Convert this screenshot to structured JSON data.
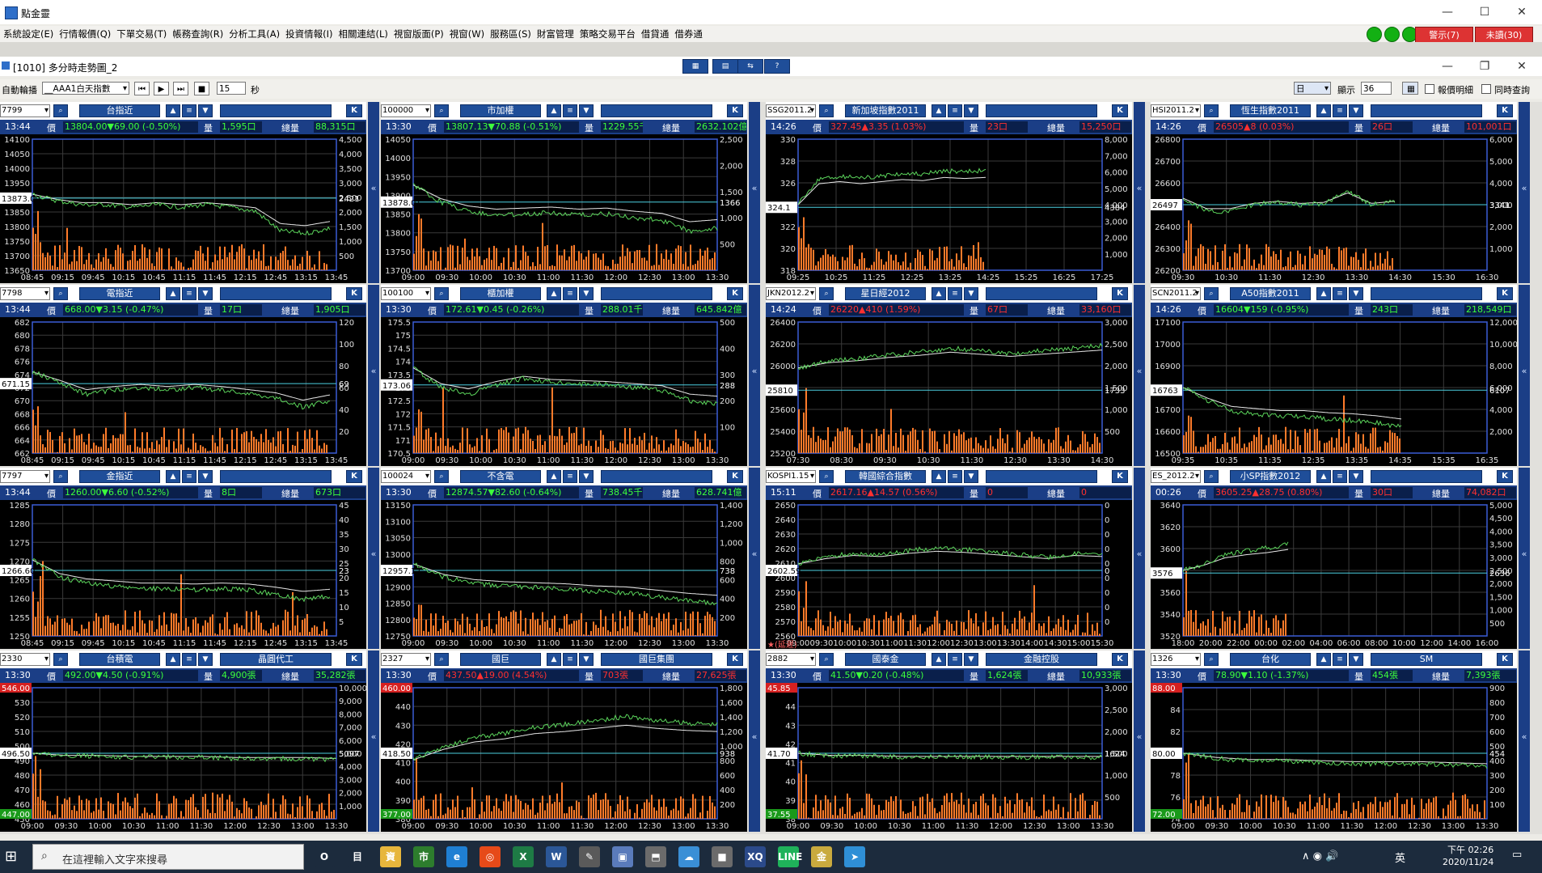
{
  "app": {
    "title": "點金靈"
  },
  "menu": [
    "系統設定(E)",
    "行情報價(Q)",
    "下單交易(T)",
    "帳務查詢(R)",
    "分析工具(A)",
    "投資情報(I)",
    "相關連結(L)",
    "視窗版面(P)",
    "視窗(W)",
    "服務區(S)",
    "財富管理",
    "策略交易平台",
    "借貸通",
    "借券通"
  ],
  "alerts": {
    "warning": "警示(7)",
    "unfilled": "未讀(30)"
  },
  "subwindow": {
    "title": "[1010] 多分時走勢圖_2"
  },
  "toolbar": {
    "auto_label": "自動輪播",
    "group": "__AAA1白天指數",
    "interval": "15",
    "sec_label": "秒",
    "period": "日",
    "display_label": "顯示",
    "display_value": "36",
    "quote_detail": "報價明細",
    "sync_query": "同時查詢"
  },
  "labels": {
    "price": "價",
    "vol": "量",
    "total": "總量"
  },
  "accent": {
    "up": "#ff2a2a",
    "down": "#1ee61e",
    "panel_header": "#1f4e99",
    "info_bar": "#1b3e86",
    "volume": "#ff7b2a"
  },
  "panels": [
    {
      "code": "7799",
      "name": "台指近",
      "name2": "",
      "time": "13:44",
      "price": "13804.00▼69.00 (-0.50%)",
      "vol": "1,595口",
      "total": "88,315口",
      "dir": "down",
      "left_ticks": [
        "14100",
        "14050",
        "14000",
        "13950",
        "13900",
        "13850",
        "13800",
        "13750",
        "13700",
        "13650"
      ],
      "right_ticks": [
        "4,500",
        "4,000",
        "3,500",
        "3,000",
        "2,500",
        "2,000",
        "1,500",
        "1,000",
        "500"
      ],
      "ref": "13873.00",
      "ref_r": "2421",
      "x_ticks": [
        "08:45",
        "09:15",
        "09:45",
        "10:15",
        "10:45",
        "11:15",
        "11:45",
        "12:15",
        "12:45",
        "13:15",
        "13:45"
      ],
      "tl": "",
      "bl": "",
      "prog": 0.98,
      "ref_pos": 0.45,
      "trend": [
        0.42,
        0.47,
        0.5,
        0.5,
        0.52,
        0.5,
        0.52,
        0.5,
        0.52,
        0.55,
        0.7,
        0.72,
        0.68
      ]
    },
    {
      "code": "100000",
      "name": "市加權",
      "name2": "",
      "time": "13:30",
      "price": "13807.13▼70.88 (-0.51%)",
      "vol": "1229.55千萬",
      "total": "2632.102億",
      "dir": "down",
      "left_ticks": [
        "14050",
        "14000",
        "13950",
        "13900",
        "13850",
        "13800",
        "13750",
        "13700"
      ],
      "right_ticks": [
        "2,500",
        "2,000",
        "1,500",
        "1,000",
        "500"
      ],
      "ref": "13878.01",
      "ref_r": "1366",
      "x_ticks": [
        "09:00",
        "09:30",
        "10:00",
        "10:30",
        "11:00",
        "11:30",
        "12:00",
        "12:30",
        "13:00",
        "13:30"
      ],
      "tl": "",
      "bl": "",
      "prog": 1.0,
      "ref_pos": 0.48,
      "trend": [
        0.35,
        0.48,
        0.55,
        0.58,
        0.57,
        0.56,
        0.58,
        0.57,
        0.6,
        0.62,
        0.7,
        0.68
      ]
    },
    {
      "code": "SSG2011.2",
      "name": "新加坡指數2011",
      "name2": "",
      "time": "14:26",
      "price": "327.45▲3.35 (1.03%)",
      "vol": "23口",
      "total": "15,250口",
      "dir": "up",
      "left_ticks": [
        "330",
        "328",
        "326",
        "324",
        "322",
        "320",
        "318"
      ],
      "right_ticks": [
        "8,000",
        "7,000",
        "6,000",
        "5,000",
        "4,000",
        "3,000",
        "2,000",
        "1,000"
      ],
      "ref": "324.1",
      "ref_r": "4384",
      "x_ticks": [
        "09:25",
        "10:25",
        "11:25",
        "12:25",
        "13:25",
        "14:25",
        "15:25",
        "16:25",
        "17:25"
      ],
      "tl": "",
      "bl": "",
      "prog": 0.62,
      "ref_pos": 0.52,
      "trend": [
        0.5,
        0.3,
        0.28,
        0.3,
        0.28,
        0.26,
        0.27,
        0.24,
        0.25,
        0.24
      ]
    },
    {
      "code": "HSI2011.2",
      "name": "恆生指數2011",
      "name2": "",
      "time": "14:26",
      "price": "26505▲8 (0.03%)",
      "vol": "26口",
      "total": "101,001口",
      "dir": "up",
      "left_ticks": [
        "26800",
        "26700",
        "26600",
        "26500",
        "26400",
        "26300",
        "26200"
      ],
      "right_ticks": [
        "6,000",
        "5,000",
        "4,000",
        "3,000",
        "2,000",
        "1,000"
      ],
      "ref": "26497",
      "ref_r": "3341",
      "x_ticks": [
        "09:30",
        "10:30",
        "11:30",
        "12:30",
        "13:30",
        "14:30",
        "15:30",
        "16:30"
      ],
      "tl": "",
      "bl": "",
      "prog": 0.7,
      "ref_pos": 0.5,
      "trend": [
        0.45,
        0.55,
        0.55,
        0.5,
        0.48,
        0.5,
        0.49,
        0.4,
        0.5,
        0.48
      ]
    },
    {
      "code": "7798",
      "name": "電指近",
      "name2": "",
      "time": "13:44",
      "price": "668.00▼3.15 (-0.47%)",
      "vol": "17口",
      "total": "1,905口",
      "dir": "down",
      "left_ticks": [
        "682",
        "680",
        "678",
        "676",
        "674",
        "672",
        "670",
        "668",
        "666",
        "664",
        "662"
      ],
      "right_ticks": [
        "120",
        "100",
        "80",
        "60",
        "40",
        "20"
      ],
      "ref": "671.15",
      "ref_r": "69",
      "x_ticks": [
        "08:45",
        "09:15",
        "09:45",
        "10:15",
        "10:45",
        "11:15",
        "11:45",
        "12:15",
        "12:45",
        "13:15",
        "13:45"
      ],
      "tl": "",
      "bl": "",
      "prog": 0.98,
      "ref_pos": 0.47,
      "trend": [
        0.38,
        0.46,
        0.55,
        0.52,
        0.5,
        0.52,
        0.5,
        0.52,
        0.55,
        0.58,
        0.65,
        0.6
      ]
    },
    {
      "code": "100100",
      "name": "櫃加權",
      "name2": "",
      "time": "13:30",
      "price": "172.61▼0.45 (-0.26%)",
      "vol": "288.01千萬",
      "total": "645.842億",
      "dir": "down",
      "left_ticks": [
        "175.5",
        "175",
        "174.5",
        "174",
        "173.5",
        "173",
        "172.5",
        "172",
        "171.5",
        "171",
        "170.5"
      ],
      "right_ticks": [
        "500",
        "400",
        "300",
        "200",
        "100"
      ],
      "ref": "173.06",
      "ref_r": "288",
      "x_ticks": [
        "09:00",
        "09:30",
        "10:00",
        "10:30",
        "11:00",
        "11:30",
        "12:00",
        "12:30",
        "13:00",
        "13:30"
      ],
      "tl": "",
      "bl": "",
      "prog": 1.0,
      "ref_pos": 0.48,
      "trend": [
        0.35,
        0.5,
        0.55,
        0.48,
        0.43,
        0.46,
        0.47,
        0.48,
        0.5,
        0.52,
        0.6,
        0.62
      ]
    },
    {
      "code": "JKN2012.2",
      "name": "星日經2012",
      "name2": "",
      "time": "14:24",
      "price": "26220▲410 (1.59%)",
      "vol": "67口",
      "total": "33,160口",
      "dir": "up",
      "left_ticks": [
        "26400",
        "26200",
        "26000",
        "25800",
        "25600",
        "25400",
        "25200"
      ],
      "right_ticks": [
        "3,000",
        "2,500",
        "2,000",
        "1,500",
        "1,000",
        "500"
      ],
      "ref": "25810",
      "ref_r": "1733",
      "x_ticks": [
        "07:30",
        "08:30",
        "09:30",
        "10:30",
        "11:30",
        "12:30",
        "13:30",
        "14:30"
      ],
      "tl": "",
      "bl": "",
      "prog": 1.0,
      "ref_pos": 0.52,
      "trend": [
        0.35,
        0.3,
        0.28,
        0.25,
        0.23,
        0.2,
        0.22,
        0.24,
        0.22,
        0.2,
        0.18
      ]
    },
    {
      "code": "SCN2011.2",
      "name": "A50指數2011",
      "name2": "",
      "time": "14:26",
      "price": "16604▼159 (-0.95%)",
      "vol": "243口",
      "total": "218,549口",
      "dir": "down",
      "left_ticks": [
        "17100",
        "17000",
        "16900",
        "16800",
        "16700",
        "16600",
        "16500"
      ],
      "right_ticks": [
        "12,000",
        "10,000",
        "8,000",
        "6,000",
        "4,000",
        "2,000"
      ],
      "ref": "16763",
      "ref_r": "6107",
      "x_ticks": [
        "09:35",
        "10:35",
        "11:35",
        "12:35",
        "13:35",
        "14:35",
        "15:35",
        "16:35"
      ],
      "tl": "",
      "bl": "",
      "prog": 0.72,
      "ref_pos": 0.52,
      "trend": [
        0.5,
        0.6,
        0.68,
        0.7,
        0.72,
        0.72,
        0.74,
        0.75,
        0.77,
        0.8
      ]
    },
    {
      "code": "7797",
      "name": "金指近",
      "name2": "",
      "time": "13:44",
      "price": "1260.00▼6.60 (-0.52%)",
      "vol": "8口",
      "total": "673口",
      "dir": "down",
      "left_ticks": [
        "1285",
        "1280",
        "1275",
        "1270",
        "1265",
        "1260",
        "1255",
        "1250"
      ],
      "right_ticks": [
        "45",
        "40",
        "35",
        "30",
        "25",
        "20",
        "15",
        "10",
        "5"
      ],
      "ref": "1266.60",
      "ref_r": "23",
      "x_ticks": [
        "08:45",
        "09:15",
        "09:45",
        "10:15",
        "10:45",
        "11:15",
        "11:45",
        "12:15",
        "12:45",
        "13:15",
        "13:45"
      ],
      "tl": "",
      "bl": "",
      "prog": 0.98,
      "ref_pos": 0.5,
      "trend": [
        0.42,
        0.55,
        0.6,
        0.62,
        0.64,
        0.64,
        0.65,
        0.64,
        0.65,
        0.68,
        0.72,
        0.7
      ]
    },
    {
      "code": "100024",
      "name": "不含電",
      "name2": "",
      "time": "13:30",
      "price": "12874.57▼82.60 (-0.64%)",
      "vol": "738.45千萬",
      "total": "628.741億",
      "dir": "down",
      "left_ticks": [
        "13150",
        "13100",
        "13050",
        "13000",
        "12950",
        "12900",
        "12850",
        "12800",
        "12750"
      ],
      "right_ticks": [
        "1,400",
        "1,200",
        "1,000",
        "800",
        "600",
        "400",
        "200"
      ],
      "ref": "12957.17",
      "ref_r": "738",
      "x_ticks": [
        "09:00",
        "09:30",
        "10:00",
        "10:30",
        "11:00",
        "11:30",
        "12:00",
        "12:30",
        "13:00",
        "13:30"
      ],
      "tl": "",
      "bl": "",
      "prog": 1.0,
      "ref_pos": 0.5,
      "trend": [
        0.45,
        0.55,
        0.6,
        0.62,
        0.63,
        0.64,
        0.66,
        0.67,
        0.7,
        0.73,
        0.75
      ]
    },
    {
      "code": "KOSPI1.15",
      "name": "韓國綜合指數",
      "name2": "",
      "time": "15:11",
      "price": "2617.16▲14.57 (0.56%)",
      "vol": "0",
      "total": "0",
      "dir": "up",
      "left_ticks": [
        "2650",
        "2640",
        "2630",
        "2620",
        "2610",
        "2600",
        "2590",
        "2580",
        "2570",
        "2560"
      ],
      "right_ticks": [
        "0",
        "0",
        "0",
        "0",
        "0",
        "0",
        "0",
        "0",
        "0"
      ],
      "ref": "2602.59",
      "ref_r": "0",
      "x_ticks": [
        "09:00",
        "09:30",
        "10:00",
        "10:30",
        "11:00",
        "11:30",
        "12:00",
        "12:30",
        "13:00",
        "13:30",
        "14:00",
        "14:30",
        "15:00",
        "15:30"
      ],
      "tl": "",
      "bl": "★(延遲)",
      "prog": 1.0,
      "ref_pos": 0.5,
      "trend": [
        0.45,
        0.4,
        0.37,
        0.38,
        0.35,
        0.33,
        0.34,
        0.36,
        0.38,
        0.4,
        0.37,
        0.38
      ]
    },
    {
      "code": "ES_2012.2",
      "name": "小SP指數2012",
      "name2": "",
      "time": "00:26",
      "price": "3605.25▲28.75 (0.80%)",
      "vol": "30口",
      "total": "74,082口",
      "dir": "up",
      "left_ticks": [
        "3640",
        "3620",
        "3600",
        "3580",
        "3560",
        "3540",
        "3520"
      ],
      "right_ticks": [
        "5,000",
        "4,500",
        "4,000",
        "3,500",
        "3,000",
        "2,500",
        "2,000",
        "1,500",
        "1,000",
        "500"
      ],
      "ref": "3576",
      "ref_r": "2636",
      "x_ticks": [
        "18:00",
        "20:00",
        "22:00",
        "00:00",
        "02:00",
        "04:00",
        "06:00",
        "08:00",
        "10:00",
        "12:00",
        "14:00",
        "16:00"
      ],
      "tl": "",
      "bl": "",
      "prog": 0.35,
      "ref_pos": 0.52,
      "trend": [
        0.5,
        0.45,
        0.38,
        0.35,
        0.33,
        0.3
      ]
    },
    {
      "code": "2330",
      "name": "台積電",
      "name2": "晶圓代工",
      "time": "13:30",
      "price": "492.00▼4.50 (-0.91%)",
      "vol": "4,900張",
      "total": "35,282張",
      "dir": "down",
      "left_ticks": [
        "540",
        "530",
        "520",
        "510",
        "500",
        "490",
        "480",
        "470",
        "460",
        "450"
      ],
      "right_ticks": [
        "10,000",
        "9,000",
        "8,000",
        "7,000",
        "6,000",
        "5,000",
        "4,000",
        "3,000",
        "2,000",
        "1,000"
      ],
      "ref": "496.50",
      "ref_r": "5097",
      "x_ticks": [
        "09:00",
        "09:30",
        "10:00",
        "10:30",
        "11:00",
        "11:30",
        "12:00",
        "12:30",
        "13:00",
        "13:30"
      ],
      "tl": "546.00",
      "bl": "447.00",
      "prog": 1.0,
      "ref_pos": 0.5,
      "trend": [
        0.5,
        0.52,
        0.52,
        0.53,
        0.53,
        0.53,
        0.54,
        0.54,
        0.54,
        0.55
      ]
    },
    {
      "code": "2327",
      "name": "國巨",
      "name2": "國巨集團",
      "time": "13:30",
      "price": "437.50▲19.00 (4.54%)",
      "vol": "703張",
      "total": "27,625張",
      "dir": "up",
      "left_ticks": [
        "450",
        "440",
        "430",
        "420",
        "410",
        "400",
        "390",
        "380"
      ],
      "right_ticks": [
        "1,800",
        "1,600",
        "1,400",
        "1,200",
        "1,000",
        "800",
        "600",
        "400",
        "200"
      ],
      "ref": "418.50",
      "ref_r": "938",
      "x_ticks": [
        "09:00",
        "09:30",
        "10:00",
        "10:30",
        "11:00",
        "11:30",
        "12:00",
        "12:30",
        "13:00",
        "13:30"
      ],
      "tl": "460.00",
      "bl": "377.00",
      "prog": 1.0,
      "ref_pos": 0.5,
      "trend": [
        0.55,
        0.45,
        0.38,
        0.35,
        0.3,
        0.28,
        0.25,
        0.22,
        0.25,
        0.27,
        0.28
      ]
    },
    {
      "code": "2882",
      "name": "國泰金",
      "name2": "金融控股",
      "time": "13:30",
      "price": "41.50▼0.20 (-0.48%)",
      "vol": "1,624張",
      "total": "10,933張",
      "dir": "down",
      "left_ticks": [
        "45",
        "44",
        "43",
        "42",
        "41",
        "40",
        "39",
        "38"
      ],
      "right_ticks": [
        "3,000",
        "2,500",
        "2,000",
        "1,500",
        "1,000",
        "500"
      ],
      "ref": "41.70",
      "ref_r": "1624",
      "x_ticks": [
        "09:00",
        "09:30",
        "10:00",
        "10:30",
        "11:00",
        "11:30",
        "12:00",
        "12:30",
        "13:00",
        "13:30"
      ],
      "tl": "45.85",
      "bl": "37.55",
      "prog": 1.0,
      "ref_pos": 0.5,
      "trend": [
        0.5,
        0.52,
        0.52,
        0.53,
        0.53,
        0.53,
        0.53,
        0.53,
        0.53,
        0.53
      ]
    },
    {
      "code": "1326",
      "name": "台化",
      "name2": "SM",
      "time": "13:30",
      "price": "78.90▼1.10 (-1.37%)",
      "vol": "454張",
      "total": "7,393張",
      "dir": "down",
      "left_ticks": [
        "86",
        "84",
        "82",
        "80",
        "78",
        "76",
        "74"
      ],
      "right_ticks": [
        "900",
        "800",
        "700",
        "600",
        "500",
        "400",
        "300",
        "200",
        "100"
      ],
      "ref": "80.00",
      "ref_r": "454",
      "x_ticks": [
        "09:00",
        "09:30",
        "10:00",
        "10:30",
        "11:00",
        "11:30",
        "12:00",
        "12:30",
        "13:00",
        "13:30"
      ],
      "tl": "88.00",
      "bl": "72.00",
      "prog": 1.0,
      "ref_pos": 0.5,
      "trend": [
        0.5,
        0.54,
        0.56,
        0.56,
        0.57,
        0.58,
        0.58,
        0.58,
        0.59,
        0.6
      ]
    }
  ],
  "taskbar": {
    "search_placeholder": "在這裡輸入文字來搜尋",
    "ime": "英",
    "time": "下午 02:26",
    "date": "2020/11/24",
    "notif": "1",
    "apps": [
      "O",
      "目",
      "資",
      "市",
      "e",
      "◎",
      "X",
      "W",
      "✎",
      "▣",
      "⬒",
      "☁",
      "■",
      "XQ",
      "LINE",
      "金",
      "➤"
    ]
  }
}
